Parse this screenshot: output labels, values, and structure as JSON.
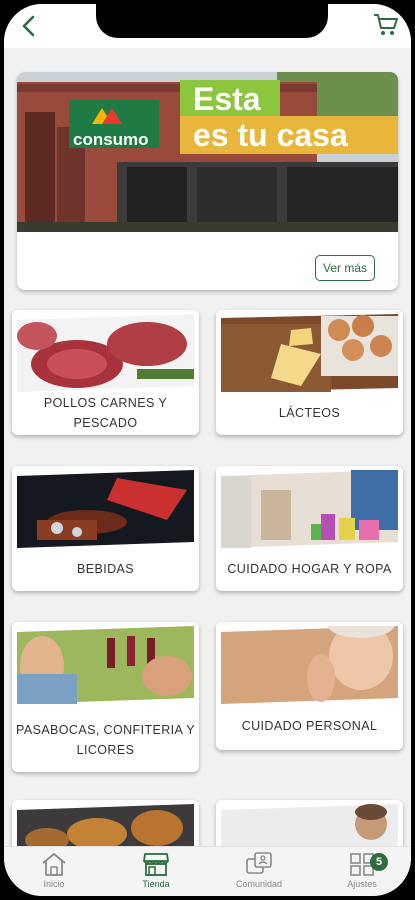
{
  "header": {
    "back_icon": "chevron-left-icon",
    "cart_icon": "shopping-cart-icon"
  },
  "banner": {
    "brand": "consumo",
    "headline_line1": "Esta",
    "headline_line2": "es tu casa",
    "button_label": "Ver más"
  },
  "categories": [
    {
      "label": "POLLOS CARNES Y PESCADO"
    },
    {
      "label": "LÁCTEOS"
    },
    {
      "label": "BEBIDAS"
    },
    {
      "label": "CUIDADO HOGAR Y ROPA"
    },
    {
      "label": "PASABOCAS, CONFITERIA Y LICORES"
    },
    {
      "label": "CUIDADO PERSONAL"
    }
  ],
  "nav": {
    "items": [
      {
        "label": "Inicio",
        "icon": "home-icon"
      },
      {
        "label": "Tienda",
        "icon": "store-icon"
      },
      {
        "label": "Comunidad",
        "icon": "community-icon"
      },
      {
        "label": "Ajustes",
        "icon": "settings-grid-icon"
      }
    ],
    "settings_badge": "5"
  },
  "colors": {
    "accent": "#2e6b3d",
    "brand_green": "#8cc63f",
    "background": "#f1f1f1"
  }
}
